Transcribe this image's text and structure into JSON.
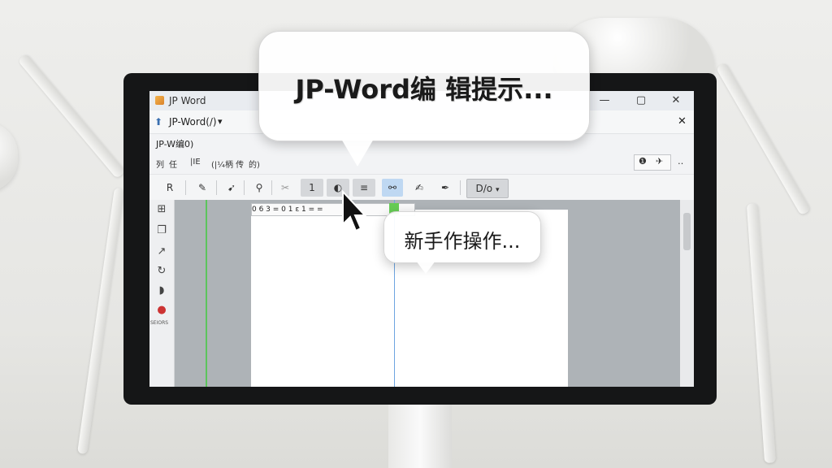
{
  "window": {
    "title": "JP Word",
    "controls": {
      "minimize": "—",
      "maximize": "▢",
      "close": "✕"
    }
  },
  "document_bar": {
    "title": "JP-Word(/)",
    "dropdown": "▾",
    "close": "✕"
  },
  "menu": {
    "title_row": "JP-W编0)",
    "items": [
      "列",
      "任",
      "|IE",
      "(|¼柄 传",
      "的)"
    ]
  },
  "right_buttons": [
    "❶",
    "✈",
    "‥"
  ],
  "toolbar": {
    "r_label": "R",
    "item_1": "1",
    "item_2": "◐",
    "item_3": "≡",
    "dropdown_label": "D/o",
    "dropdown_arrow": "▾"
  },
  "ruler_text": "0 6 3  =  0 1  ε 1  =  =",
  "left_panel_label": "SEIORS",
  "tooltips": {
    "main": "JP-Word编 辑提示...",
    "secondary": "新手作操作..."
  }
}
